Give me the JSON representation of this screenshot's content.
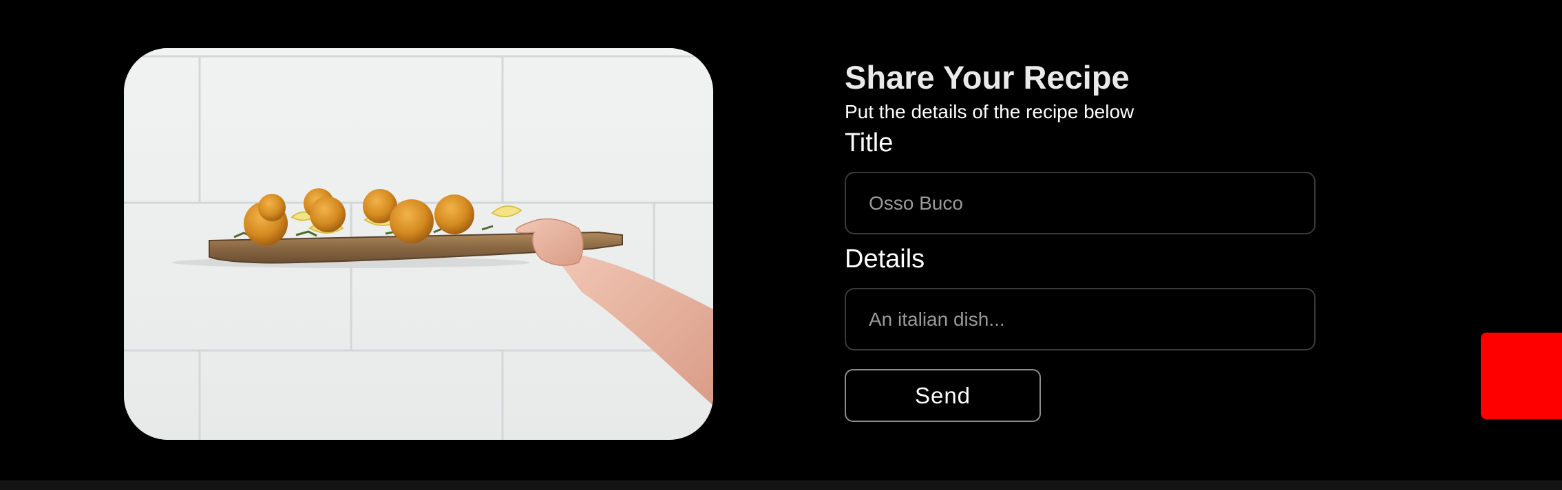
{
  "form": {
    "heading": "Share Your Recipe",
    "subheading": "Put the details of the recipe below",
    "title_label": "Title",
    "title_placeholder": "Osso Buco",
    "details_label": "Details",
    "details_placeholder": "An italian dish...",
    "send_label": "Send"
  },
  "colors": {
    "background": "#000000",
    "accent_tab": "#ff0000",
    "input_border": "#3a3a3a",
    "button_border": "#8e8e8e"
  },
  "image": {
    "subject": "hand holding a wooden board with fried rice balls and lemon wedges"
  }
}
